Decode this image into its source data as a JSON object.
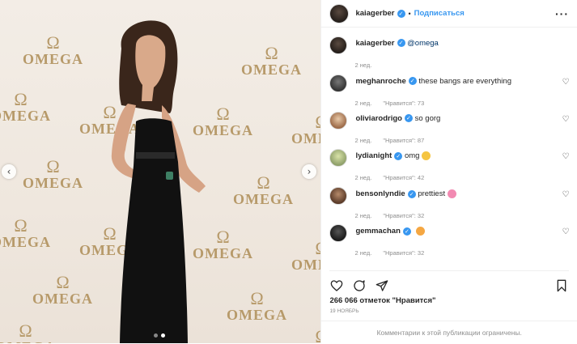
{
  "photo": {
    "logo_text": "OMEGA",
    "prev_icon": "chevron-left-icon",
    "next_icon": "chevron-right-icon",
    "dots": [
      false,
      true
    ]
  },
  "header": {
    "username": "kaiagerber",
    "separator": "•",
    "follow_label": "Подписаться",
    "more_label": "···"
  },
  "caption": {
    "username": "kaiagerber",
    "mention": "@omega",
    "time": "2 нед."
  },
  "comments": [
    {
      "username": "meghanroche",
      "text": "these bangs are everything",
      "emoji": "",
      "time": "2 нед.",
      "likes": "\"Нравится\": 73"
    },
    {
      "username": "oliviarodrigo",
      "text": "so gorg",
      "emoji": "",
      "time": "2 нед.",
      "likes": "\"Нравится\": 87"
    },
    {
      "username": "lydianight",
      "text": "omg",
      "emoji": "crying-face",
      "time": "2 нед.",
      "likes": "\"Нравится\": 42"
    },
    {
      "username": "bensonlyndie",
      "text": "prettiest",
      "emoji": "pink-flower",
      "time": "2 нед.",
      "likes": "\"Нравится\": 32"
    },
    {
      "username": "gemmachan",
      "text": "",
      "emoji": "heart-eyes",
      "time": "2 нед.",
      "likes": "\"Нравится\": 32"
    }
  ],
  "actions": {
    "icons": [
      "heart-icon",
      "comment-icon",
      "share-icon",
      "bookmark-icon"
    ]
  },
  "likes_text": "266 066 отметок \"Нравится\"",
  "date_text": "19 ноябрь",
  "limited_text": "Комментарии к этой публикации ограничены.",
  "colors": {
    "accent": "#3897f0",
    "muted": "#8e8e8e",
    "logo": "#b79a6a"
  }
}
